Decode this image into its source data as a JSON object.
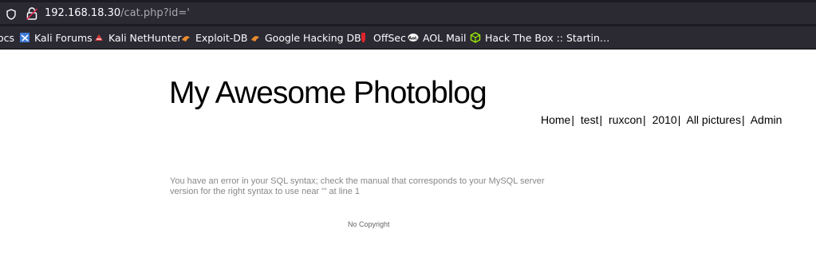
{
  "browser": {
    "url_host": "192.168.18.30",
    "url_path": "/cat.php?id='",
    "bookmarks": [
      {
        "label": "ocs",
        "icon": "docs-icon"
      },
      {
        "label": "Kali Forums",
        "icon": "kali-forums-icon"
      },
      {
        "label": "Kali NetHunter",
        "icon": "nethunter-icon"
      },
      {
        "label": "Exploit-DB",
        "icon": "exploit-db-icon"
      },
      {
        "label": "Google Hacking DB",
        "icon": "ghdb-icon"
      },
      {
        "label": "OffSec",
        "icon": "offsec-icon"
      },
      {
        "label": "AOL Mail",
        "icon": "aol-icon"
      },
      {
        "label": "Hack The Box :: Startin…",
        "icon": "htb-icon"
      }
    ]
  },
  "page": {
    "title": "My Awesome Photoblog",
    "nav": [
      "Home",
      "test",
      "ruxcon",
      "2010",
      "All pictures",
      "Admin"
    ],
    "nav_separator": "|",
    "error": "You have an error in your SQL syntax; check the manual that corresponds to your MySQL server version for the right syntax to use near ''' at line 1",
    "footer": "No Copyright"
  }
}
